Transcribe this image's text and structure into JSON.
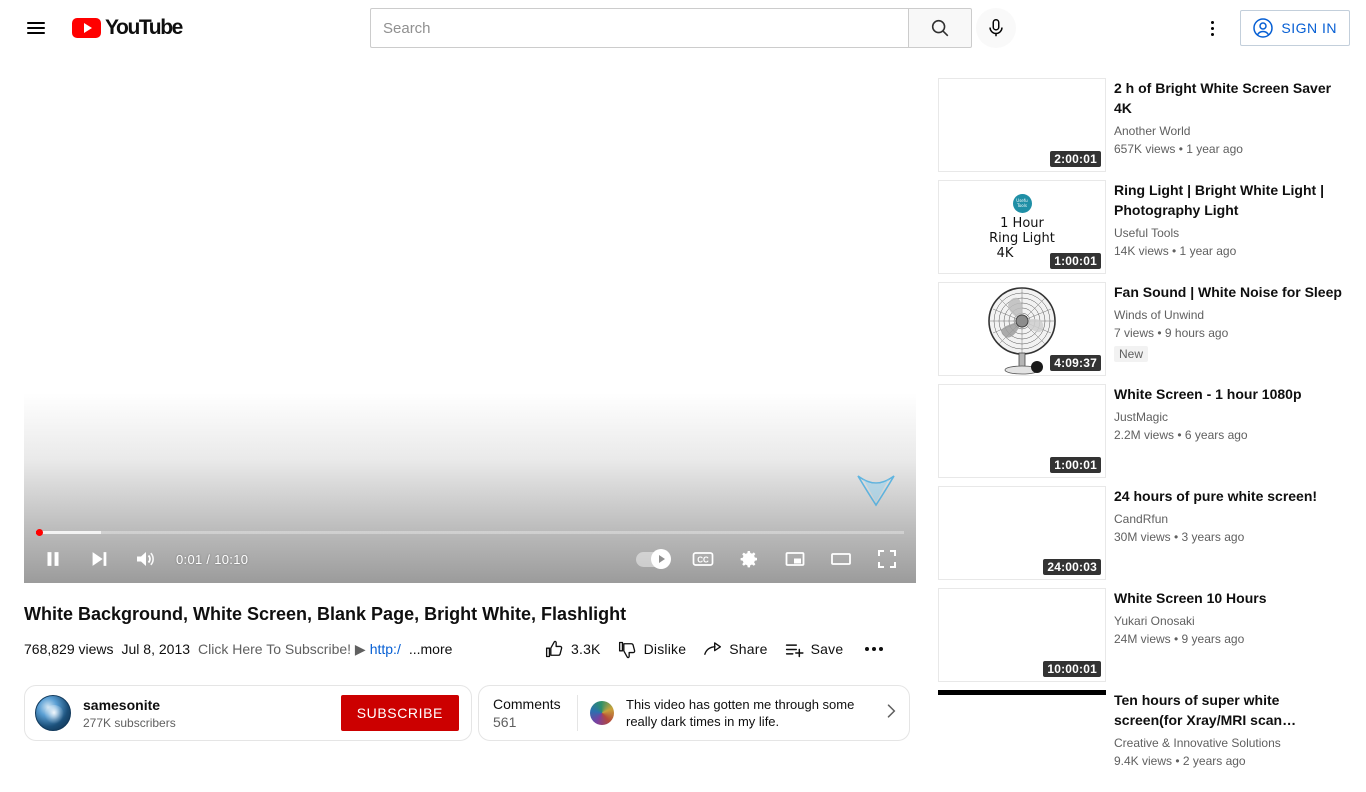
{
  "header": {
    "brand": "YouTube",
    "menu_icon": "hamburger-icon",
    "search": {
      "placeholder": "Search",
      "value": ""
    },
    "search_button_icon": "search-icon",
    "mic_button_icon": "microphone-icon",
    "kebab_icon": "more-vertical-icon",
    "sign_in_label": "SIGN IN"
  },
  "player": {
    "play_state": "playing",
    "pause_icon": "pause-icon",
    "next_icon": "next-track-icon",
    "volume_icon": "volume-on-icon",
    "time": "0:01 / 10:10",
    "current_time": "0:01",
    "duration": "10:10",
    "autoplay_label": "Autoplay",
    "autoplay_on": true,
    "cc_label": "CC",
    "settings_icon": "gear-icon",
    "miniplayer_icon": "miniplayer-icon",
    "theater_icon": "theater-mode-icon",
    "fullscreen_icon": "fullscreen-icon",
    "progress_percent": 0.16
  },
  "video": {
    "title": "White Background, White Screen, Blank Page, Bright White, Flashlight",
    "views": "768,829 views",
    "date": "Jul 8, 2013",
    "description_snippet": "Click Here To Subscribe! ▶",
    "description_link": "http:/",
    "more_label": "...more"
  },
  "actions": {
    "like": {
      "label": "3.3K",
      "icon": "thumbs-up-icon"
    },
    "dislike": {
      "label": "Dislike",
      "icon": "thumbs-down-icon"
    },
    "share": {
      "label": "Share",
      "icon": "share-icon"
    },
    "save": {
      "label": "Save",
      "icon": "save-playlist-icon"
    },
    "more_icon": "more-horizontal-icon"
  },
  "owner": {
    "channel_name": "samesonite",
    "subscribers": "277K subscribers",
    "subscribe_label": "SUBSCRIBE",
    "avatar_icon": "channel-avatar"
  },
  "comments": {
    "title": "Comments",
    "count": "561",
    "top_comment": "This video has gotten me through some really dark times in my life.",
    "chevron_icon": "chevron-right-icon"
  },
  "recommendations": [
    {
      "title": "2 h of Bright White Screen Saver 4K",
      "channel": "Another World",
      "stats": "657K views • 1 year ago",
      "duration": "2:00:01",
      "badge": null,
      "thumb": "blank-white"
    },
    {
      "title": "Ring Light | Bright White Light | Photography Light",
      "channel": "Useful Tools",
      "stats": "14K views • 1 year ago",
      "duration": "1:00:01",
      "badge": null,
      "thumb": "ring-light",
      "thumb_text": {
        "badge": "Useful Tools",
        "line1": "1 Hour",
        "line2": "Ring Light",
        "line3": "4K"
      }
    },
    {
      "title": "Fan Sound | White Noise for Sleep",
      "channel": "Winds of Unwind",
      "stats": "7 views • 9 hours ago",
      "duration": "4:09:37",
      "badge": "New",
      "thumb": "fan"
    },
    {
      "title": "White Screen - 1 hour 1080p",
      "channel": "JustMagic",
      "stats": "2.2M views • 6 years ago",
      "duration": "1:00:01",
      "badge": null,
      "thumb": "blank-white"
    },
    {
      "title": "24 hours of pure white screen!",
      "channel": "CandRfun",
      "stats": "30M views • 3 years ago",
      "duration": "24:00:03",
      "badge": null,
      "thumb": "blank-white"
    },
    {
      "title": "White Screen 10 Hours",
      "channel": "Yukari Onosaki",
      "stats": "24M views • 9 years ago",
      "duration": "10:00:01",
      "badge": null,
      "thumb": "blank-white"
    },
    {
      "title": "Ten hours of super white screen(for Xray/MRI scan…",
      "channel": "Creative & Innovative Solutions",
      "stats": "9.4K views • 2 years ago",
      "duration": "",
      "badge": null,
      "thumb": "blackbar-white"
    }
  ],
  "colors": {
    "brand_red": "#ff0000",
    "subscribe_red": "#cc0000",
    "link_blue": "#065fd4",
    "text_primary": "#0f0f0f",
    "text_secondary": "#606060"
  }
}
